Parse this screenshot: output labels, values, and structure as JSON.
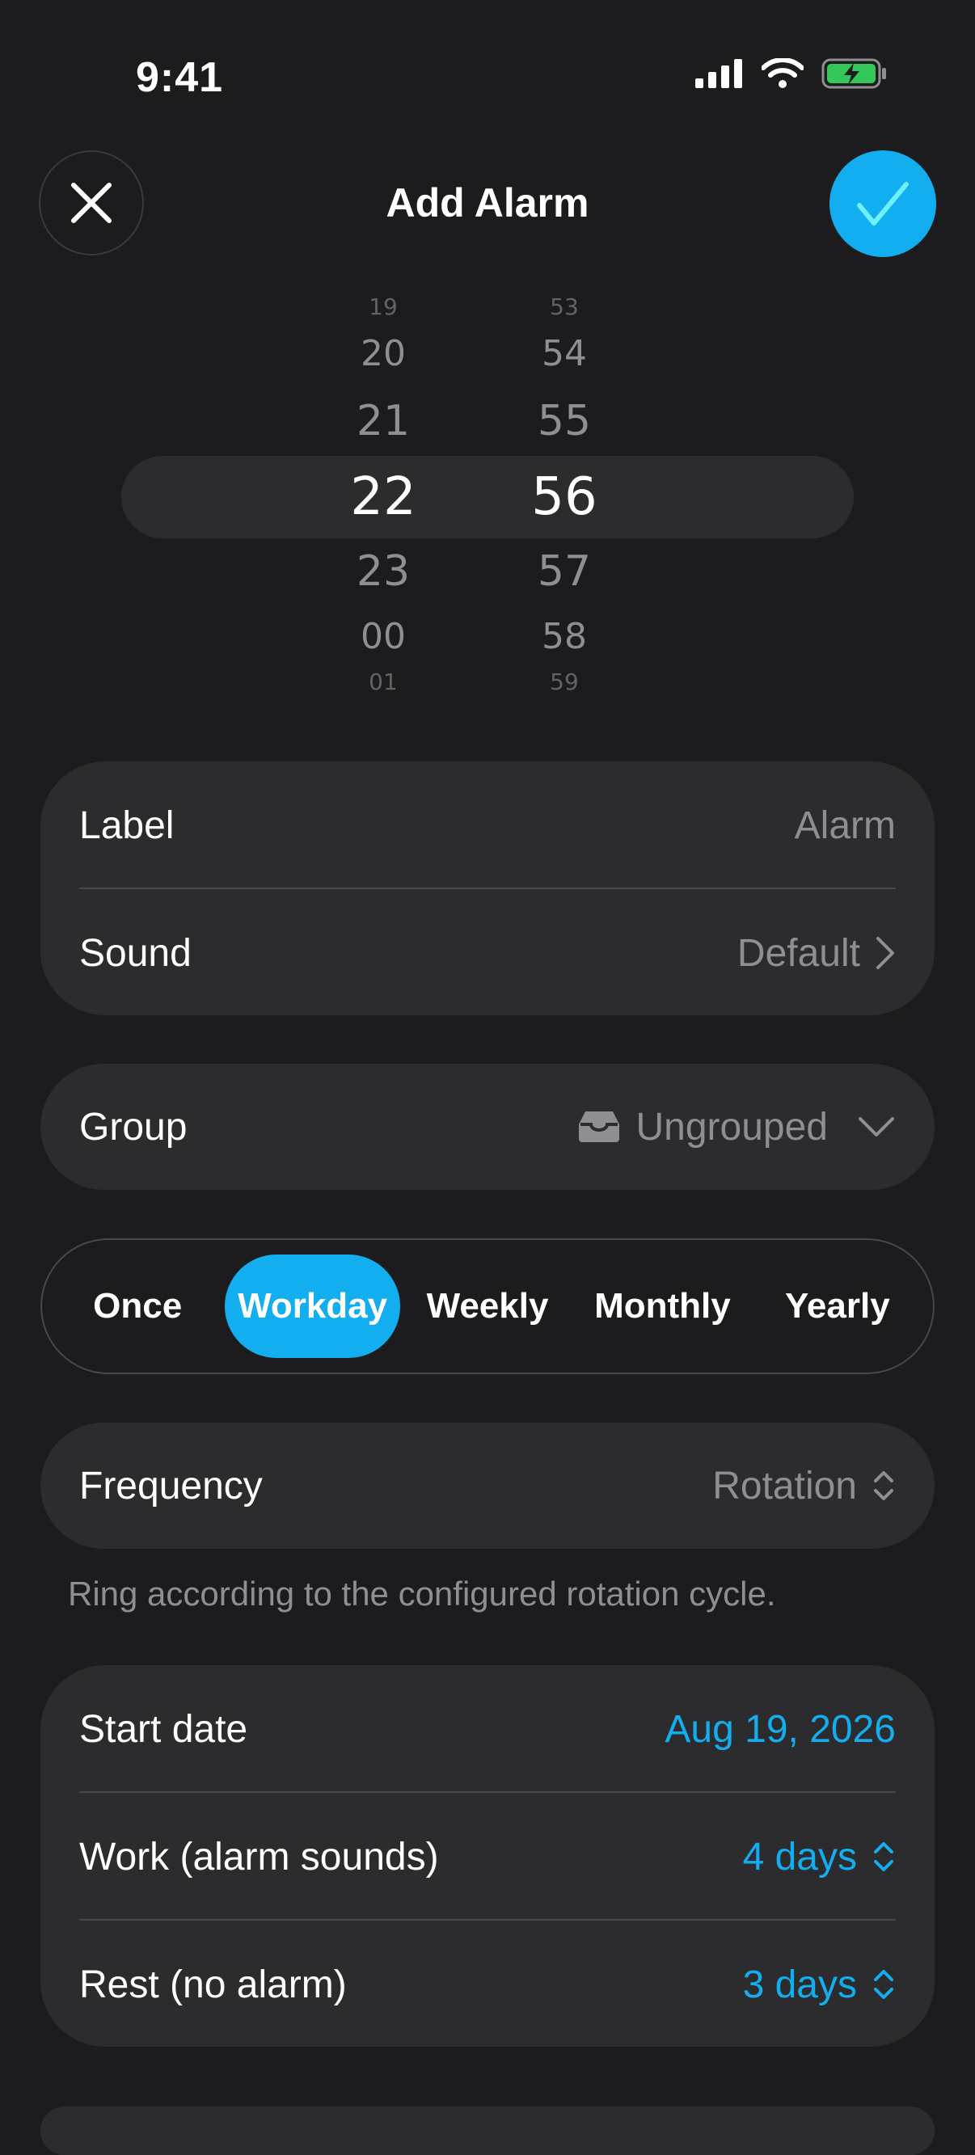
{
  "status_bar": {
    "time": "9:41"
  },
  "nav": {
    "title": "Add Alarm",
    "accent_color": "#13aef0"
  },
  "picker": {
    "hours": [
      "19",
      "20",
      "21",
      "22",
      "23",
      "00",
      "01"
    ],
    "minutes": [
      "53",
      "54",
      "55",
      "56",
      "57",
      "58",
      "59"
    ],
    "selected_hour": "22",
    "selected_minute": "56"
  },
  "card1": {
    "label": {
      "label": "Label",
      "value": "Alarm"
    },
    "sound": {
      "label": "Sound",
      "value": "Default"
    }
  },
  "group": {
    "label": "Group",
    "value": "Ungrouped"
  },
  "repeat": {
    "options": [
      "Once",
      "Workday",
      "Weekly",
      "Monthly",
      "Yearly"
    ],
    "selected": "Workday"
  },
  "frequency": {
    "label": "Frequency",
    "value": "Rotation",
    "helper": "Ring according to the configured rotation cycle."
  },
  "rotation": {
    "start_date": {
      "label": "Start date",
      "value": "Aug 19, 2026"
    },
    "work": {
      "label": "Work (alarm sounds)",
      "value": "4 days"
    },
    "rest": {
      "label": "Rest (no alarm)",
      "value": "3 days"
    }
  }
}
